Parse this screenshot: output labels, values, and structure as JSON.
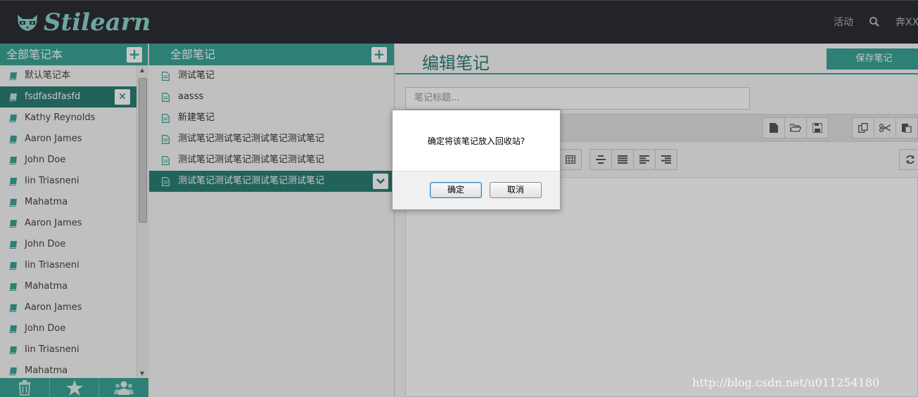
{
  "header": {
    "logo_text": "Stilearn",
    "nav_activity": "活动",
    "user_name": "奔XXX"
  },
  "notebooks": {
    "heading": "全部笔记本",
    "add_label": "+",
    "items": [
      {
        "label": "默认笔记本"
      },
      {
        "label": "fsdfasdfasfd",
        "active": true
      },
      {
        "label": "Kathy Reynolds"
      },
      {
        "label": "Aaron James"
      },
      {
        "label": "John Doe"
      },
      {
        "label": "Iin Triasneni"
      },
      {
        "label": "Mahatma"
      },
      {
        "label": "Aaron James"
      },
      {
        "label": "John Doe"
      },
      {
        "label": "Iin Triasneni"
      },
      {
        "label": "Mahatma"
      },
      {
        "label": "Aaron James"
      },
      {
        "label": "John Doe"
      },
      {
        "label": "Iin Triasneni"
      },
      {
        "label": "Mahatma"
      }
    ],
    "delete_label": "✕"
  },
  "notes": {
    "heading": "全部笔记",
    "add_label": "+",
    "items": [
      {
        "label": "测试笔记"
      },
      {
        "label": "aasss"
      },
      {
        "label": "新建笔记"
      },
      {
        "label": "测试笔记测试笔记测试笔记测试笔记"
      },
      {
        "label": "测试笔记测试笔记测试笔记测试笔记"
      },
      {
        "label": "测试笔记测试笔记测试笔记测试笔记",
        "active": true
      }
    ]
  },
  "editor": {
    "title": "编辑笔记",
    "save_label": "保存笔记",
    "title_placeholder": "笔记标题..."
  },
  "dialog": {
    "message": "确定将该笔记放入回收站?",
    "ok_label": "确定",
    "cancel_label": "取消"
  },
  "watermark": "http://blog.csdn.net/u011254180",
  "colors": {
    "accent": "#3aa596",
    "accent_dark": "#2b7f74",
    "topbar": "#2d2f35"
  }
}
